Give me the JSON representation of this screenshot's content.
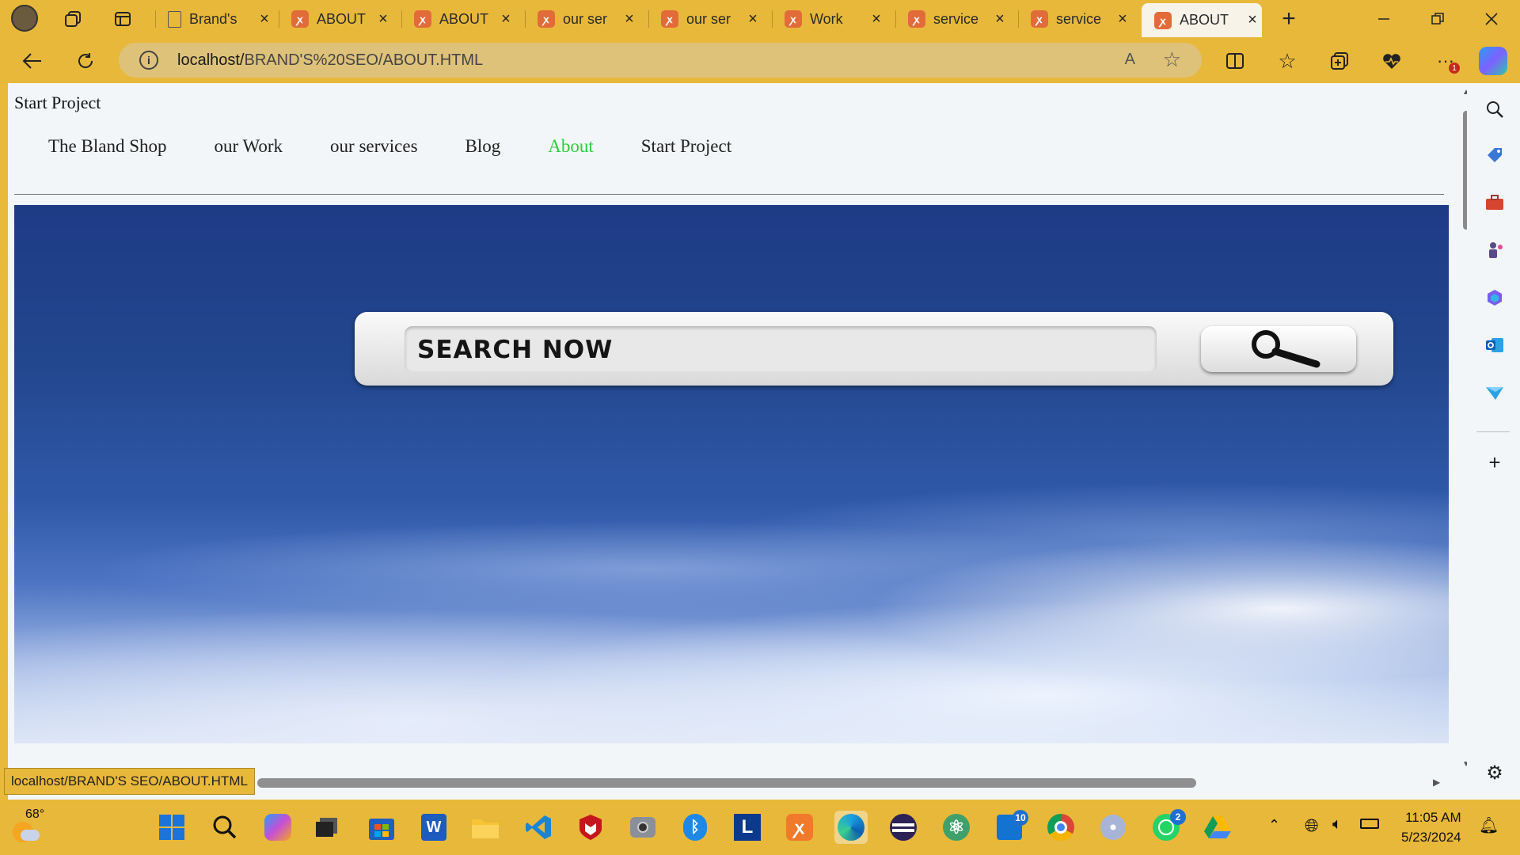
{
  "tabs": [
    {
      "title": "Brand's",
      "icon": "page-icon"
    },
    {
      "title": "ABOUT",
      "icon": "xampp-icon"
    },
    {
      "title": "ABOUT",
      "icon": "xampp-icon"
    },
    {
      "title": "our ser",
      "icon": "xampp-icon"
    },
    {
      "title": "our ser",
      "icon": "xampp-icon"
    },
    {
      "title": "Work",
      "icon": "xampp-icon"
    },
    {
      "title": "service",
      "icon": "xampp-icon"
    },
    {
      "title": "service",
      "icon": "xampp-icon"
    },
    {
      "title": "ABOUT",
      "icon": "xampp-icon",
      "active": true
    }
  ],
  "address": {
    "host": "localhost/",
    "path": "BRAND'S%20SEO/ABOUT.HTML"
  },
  "page": {
    "title": "Start Project",
    "nav": [
      "The Bland Shop",
      "our Work",
      "our services",
      "Blog",
      "About",
      "Start Project"
    ],
    "active_nav": "About",
    "hero_search_text": "SEARCH NOW"
  },
  "status_url": "localhost/BRAND'S SEO/ABOUT.HTML",
  "taskbar": {
    "weather": "68°",
    "time": "11:05 AM",
    "date": "5/23/2024",
    "badge_outlook": "10",
    "badge_whatsapp": "2"
  },
  "colors": {
    "chrome": "#e8b83a",
    "active_nav": "#2ecc40"
  }
}
